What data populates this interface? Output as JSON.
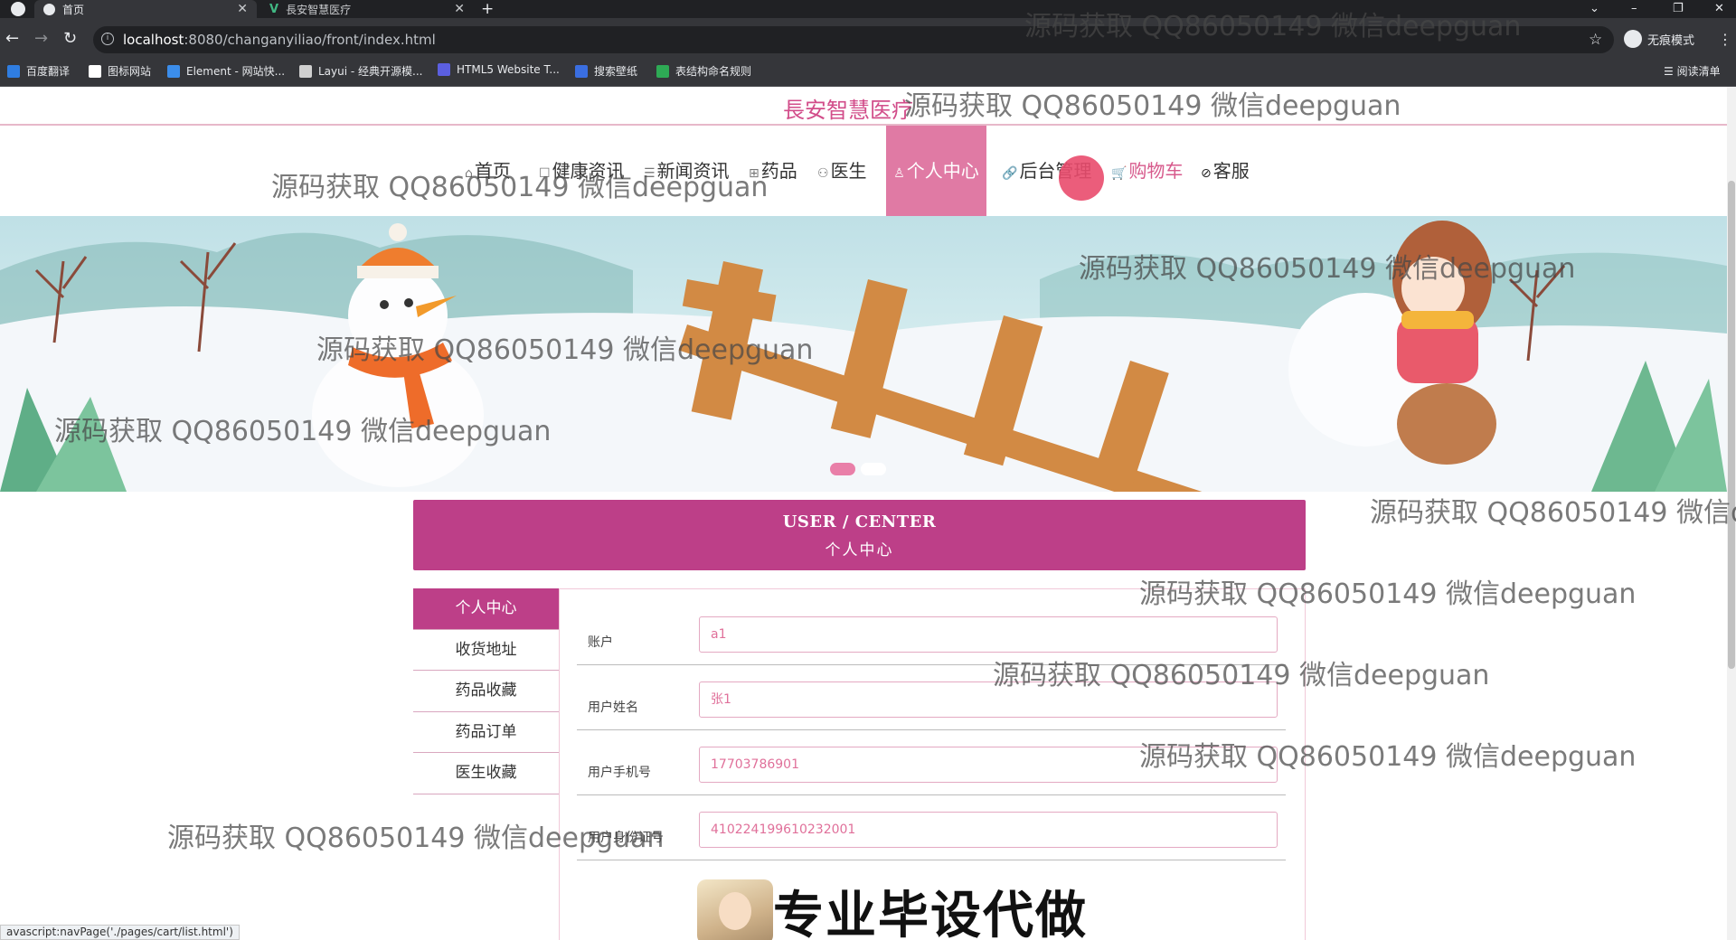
{
  "browser": {
    "tabs": [
      {
        "title": "首页",
        "active": true
      },
      {
        "title": "長安智慧医疗",
        "active": false
      }
    ],
    "url_host": "localhost",
    "url_rest": ":8080/changanyiliao/front/index.html",
    "profile_label": "无痕模式",
    "bookmarks": [
      "百度翻译",
      "图标网站",
      "Element - 网站快...",
      "Layui - 经典开源模...",
      "HTML5 Website T...",
      "搜索壁纸",
      "表结构命名规则"
    ],
    "bookmark_colors": [
      "#2f7de1",
      "#ffffff",
      "#3b8dea",
      "#d0d0d0",
      "#5b5fe0",
      "#3a6ee0",
      "#2eaa55"
    ],
    "reading_list": "阅读清单",
    "status_url": "avascript:navPage('./pages/cart/list.html')"
  },
  "site": {
    "title": "長安智慧医疗",
    "menu": [
      {
        "label": "首页",
        "icon": "home-icon",
        "glyph": "⌂"
      },
      {
        "label": "健康资讯",
        "icon": "news-icon",
        "glyph": "☐"
      },
      {
        "label": "新闻资讯",
        "icon": "list-icon",
        "glyph": "☰"
      },
      {
        "label": "药品",
        "icon": "medicine-icon",
        "glyph": "⊞"
      },
      {
        "label": "医生",
        "icon": "doctor-icon",
        "glyph": "⚇"
      },
      {
        "label": "个人中心",
        "icon": "user-icon",
        "glyph": "♙"
      },
      {
        "label": "后台管理",
        "icon": "link-icon",
        "glyph": "🔗"
      },
      {
        "label": "购物车",
        "icon": "cart-icon",
        "glyph": "🛒"
      },
      {
        "label": "客服",
        "icon": "service-icon",
        "glyph": "⊘"
      }
    ],
    "accent": "#bd3f88",
    "menu_active_color": "#e07aa4"
  },
  "user_center": {
    "title_en": "USER / CENTER",
    "title_cn": "个人中心",
    "side_menu": [
      "个人中心",
      "收货地址",
      "药品收藏",
      "药品订单",
      "医生收藏"
    ],
    "fields": [
      {
        "label": "账户",
        "value": "a1"
      },
      {
        "label": "用户姓名",
        "value": "张1"
      },
      {
        "label": "用户手机号",
        "value": "17703786901"
      },
      {
        "label": "用户身份证号",
        "value": "410224199610232001"
      }
    ]
  },
  "promo": {
    "text": "专业毕设代做"
  },
  "watermark": "源码获取 QQ86050149 微信deepguan"
}
